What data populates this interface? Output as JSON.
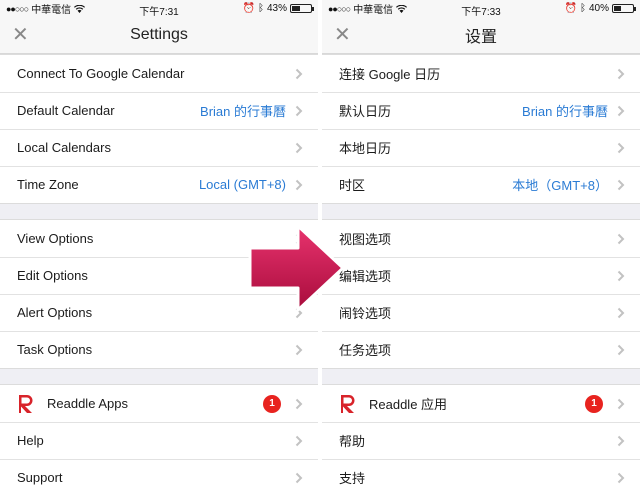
{
  "left": {
    "status": {
      "carrier": "中華電信",
      "time": "下午7:31",
      "battery": "43%",
      "battery_level": 0.43
    },
    "nav": {
      "title": "Settings"
    },
    "groups": [
      [
        {
          "label": "Connect To Google Calendar",
          "value": ""
        },
        {
          "label": "Default Calendar",
          "value": "Brian 的行事曆"
        },
        {
          "label": "Local Calendars",
          "value": ""
        },
        {
          "label": "Time Zone",
          "value": "Local (GMT+8)"
        }
      ],
      [
        {
          "label": "View Options"
        },
        {
          "label": "Edit Options"
        },
        {
          "label": "Alert Options"
        },
        {
          "label": "Task Options"
        }
      ],
      [
        {
          "label": "Readdle Apps",
          "badge": "1"
        },
        {
          "label": "Help"
        },
        {
          "label": "Support"
        }
      ]
    ]
  },
  "right": {
    "status": {
      "carrier": "中華電信",
      "time": "下午7:33",
      "battery": "40%",
      "battery_level": 0.4
    },
    "nav": {
      "title": "设置"
    },
    "groups": [
      [
        {
          "label": "连接 Google 日历",
          "value": ""
        },
        {
          "label": "默认日历",
          "value": "Brian 的行事曆"
        },
        {
          "label": "本地日历",
          "value": ""
        },
        {
          "label": "时区",
          "value": "本地（GMT+8）"
        }
      ],
      [
        {
          "label": "视图选项"
        },
        {
          "label": "编辑选项"
        },
        {
          "label": "闹铃选项"
        },
        {
          "label": "任务选项"
        }
      ],
      [
        {
          "label": "Readdle 应用",
          "badge": "1"
        },
        {
          "label": "帮助"
        },
        {
          "label": "支持"
        }
      ]
    ]
  },
  "colors": {
    "accent": "#2a7bd4",
    "badge": "#e8231f",
    "arrow": "#c8104a",
    "logo": "#d8232a"
  },
  "icons": [
    "close-icon",
    "chevron-right-icon",
    "readdle-logo-icon",
    "wifi-icon",
    "bluetooth-icon",
    "alarm-icon",
    "battery-icon",
    "arrow-right-icon"
  ]
}
